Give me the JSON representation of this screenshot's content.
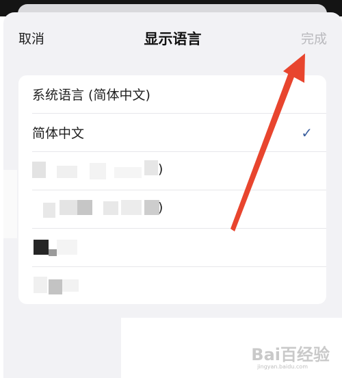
{
  "nav": {
    "cancel_label": "取消",
    "title": "显示语言",
    "done_label": "完成"
  },
  "languages": [
    {
      "label": "系统语言 (简体中文)",
      "selected": false
    },
    {
      "label": "简体中文",
      "selected": true
    }
  ],
  "blurred_rows": [
    ")",
    ")"
  ],
  "check_glyph": "✓",
  "watermark": {
    "main": "Bai百经验",
    "sub": "jingyan.baidu.com"
  },
  "annotation_color": "#e8452e"
}
